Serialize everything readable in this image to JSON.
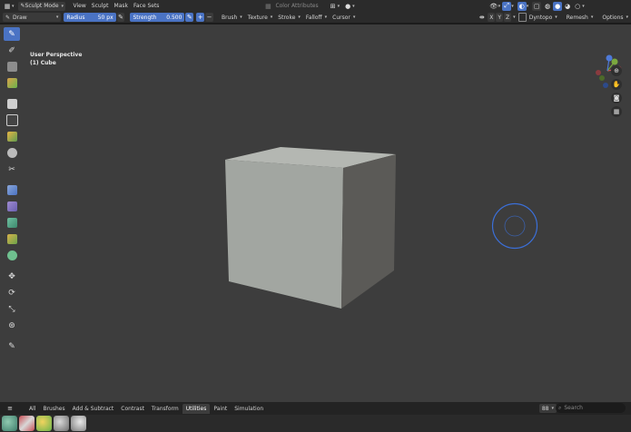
{
  "topbar": {
    "mode_label": "Sculpt Mode",
    "menus": [
      "View",
      "Sculpt",
      "Mask",
      "Face Sets"
    ],
    "color_attributes_label": "Color Attributes"
  },
  "toolhdr": {
    "tool_label": "Draw",
    "radius_label": "Radius",
    "radius_value": "50 px",
    "strength_label": "Strength",
    "strength_value": "0.500",
    "menus": [
      "Brush",
      "Texture",
      "Stroke",
      "Falloff",
      "Cursor"
    ],
    "axis_x": "X",
    "axis_y": "Y",
    "axis_z": "Z",
    "dyntopo_label": "Dyntopo",
    "remesh_label": "Remesh",
    "options_label": "Options"
  },
  "viewport": {
    "perspective_label": "User Perspective",
    "object_label": "(1) Cube",
    "gizmo": {
      "x": "X",
      "y": "Y",
      "z": "Z"
    }
  },
  "bottom_tabs": [
    "All",
    "Brushes",
    "Add & Subtract",
    "Contrast",
    "Transform",
    "Utilities",
    "Paint",
    "Simulation"
  ],
  "active_tab": "Utilities",
  "bottom_right": {
    "view_count": "88",
    "search_placeholder": "Search"
  },
  "colors": {
    "accent": "#4a73c4",
    "viewport_bg": "#3d3d3d",
    "header_bg": "#2b2b2b",
    "brush_cursor": "#3b6fd8"
  },
  "icons": {
    "left_tools": [
      "draw-brush-icon",
      "draw-sharp-icon",
      "clay-icon",
      "clay-strips-icon",
      "layer-icon",
      "inflate-icon",
      "blob-icon",
      "crease-icon",
      "smooth-icon",
      "flatten-icon",
      "fill-icon",
      "scrape-icon",
      "multiplane-scrape-icon",
      "pinch-icon",
      "move-icon",
      "rotate-icon",
      "scale-icon",
      "transform-icon",
      "annotate-icon"
    ],
    "nav": [
      "zoom-icon",
      "hand-pan-icon",
      "camera-icon",
      "grid-ortho-icon"
    ]
  }
}
